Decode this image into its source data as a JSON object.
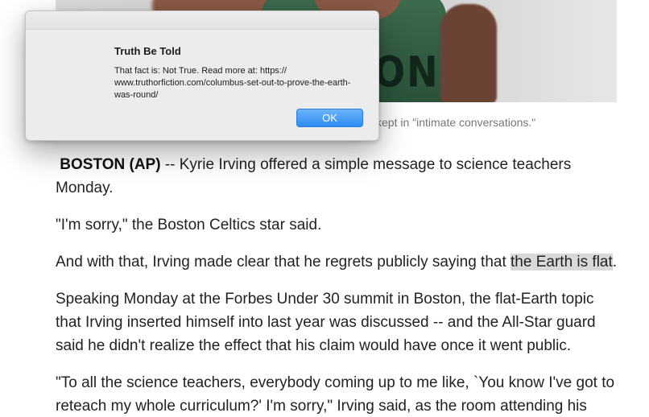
{
  "photo": {
    "jersey_text": "ON"
  },
  "caption": "kept in \"intimate conversations.\"",
  "dialog": {
    "title": "Truth Be Told",
    "message": "That fact is: Not True. Read more at: https:// www.truthorfiction.com/columbus-set-out-to-prove-the-earth-was-round/",
    "ok_label": "OK"
  },
  "article": {
    "dateline": "BOSTON (AP)",
    "p1_rest": " -- Kyrie Irving offered a simple message to science teachers Monday.",
    "p2": "\"I'm sorry,\" the Boston Celtics star said.",
    "p3_before": "And with that, Irving made clear that he regrets publicly saying that ",
    "p3_highlight": "the Earth is flat",
    "p3_after": ".",
    "p4": "Speaking Monday at the Forbes Under 30 summit in Boston, the flat-Earth topic that Irving inserted himself into last year was discussed -- and the All-Star guard said he didn't realize the effect that his claim would have once it went public.",
    "p5": "\"To all the science teachers, everybody coming up to me like, `You know I've got to reteach my whole curriculum?' I'm sorry,\" Irving said, as the room attending his"
  },
  "colors": {
    "highlight": "#d9d9d9",
    "button_blue": "#2d8cf0",
    "text": "#222222"
  }
}
